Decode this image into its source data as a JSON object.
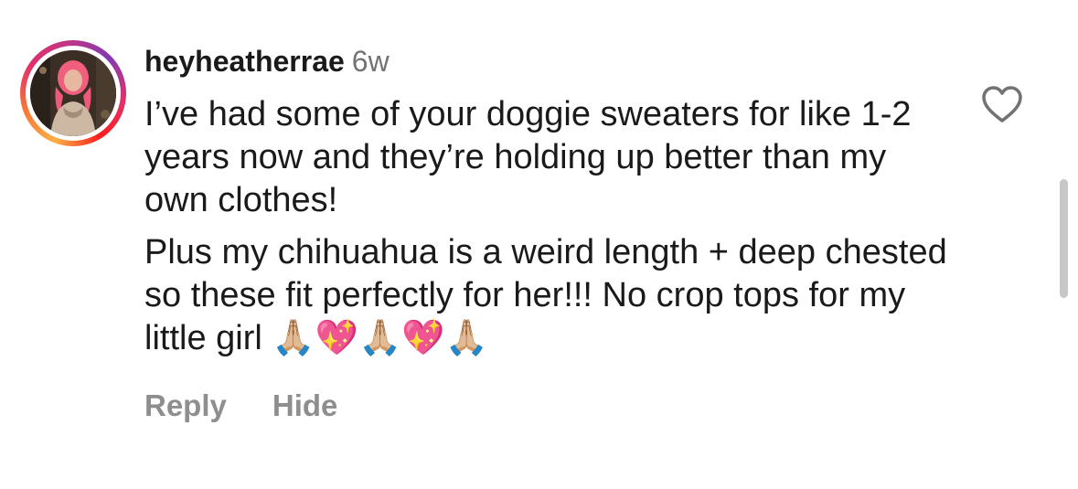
{
  "comment": {
    "username": "heyheatherrae",
    "age": "6w",
    "paragraphs": [
      "I’ve had some of your doggie sweaters for like 1-2 years now and they’re holding up better than my own clothes!",
      "Plus my chihuahua is a weird length + deep chested so these fit perfectly for her!!! No crop tops for my little girl 🙏🏼💖🙏🏼💖🙏🏼"
    ],
    "actions": {
      "reply_label": "Reply",
      "hide_label": "Hide"
    },
    "icons": {
      "like": "heart-outline-icon",
      "avatar_ring": "story-ring"
    }
  },
  "colors": {
    "text": "#1a1a1a",
    "secondary_text": "#737373",
    "action_text": "#8e8e8e",
    "scrollbar": "#c7c7c7",
    "ring_gradient": [
      "#fcaf45",
      "#f77737",
      "#e1306c",
      "#c13584",
      "#833ab4"
    ]
  }
}
